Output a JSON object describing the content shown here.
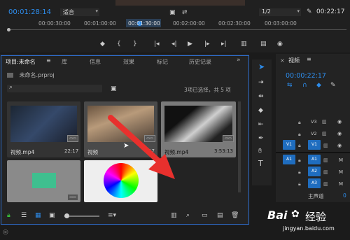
{
  "program_monitor": {
    "timecode": "00:01:28:14",
    "fit_label": "适合",
    "resolution": "1/2",
    "end_timecode": "00:22:17",
    "ruler_ticks": [
      "00:00:30:00",
      "00:01:00:00",
      "00:01:30:00",
      "00:02:00:00",
      "00:02:30:00",
      "00:03:00:00"
    ]
  },
  "project_panel": {
    "tabs": [
      "项目:未命名",
      "库",
      "信息",
      "效果",
      "标记",
      "历史记录"
    ],
    "file_name": "未命名.prproj",
    "search_placeholder": "",
    "selection_info": "3项已选择，共 5 项",
    "clips": [
      {
        "name": "视频.mp4",
        "duration": "22:17"
      },
      {
        "name": "视频",
        "duration": "17"
      },
      {
        "name": "视频.mp4",
        "duration": "3:53:13"
      }
    ]
  },
  "timeline": {
    "tab_label": "视频",
    "timecode": "00:00:22:17",
    "video_tracks": [
      "V3",
      "V2",
      "V1"
    ],
    "audio_tracks": [
      "A1",
      "A2",
      "A3"
    ],
    "source_v": "V1",
    "source_a": "A1",
    "master_label": "主声道",
    "master_value": "0"
  },
  "watermark": {
    "brand": "Bai",
    "brand_cn": "经验",
    "url": "jingyan.baidu.com"
  },
  "colors": {
    "accent": "#2d8ceb",
    "arrow": "#e8302d",
    "panel_bg": "#232323",
    "thumb_bg": "#3a3a3a"
  }
}
